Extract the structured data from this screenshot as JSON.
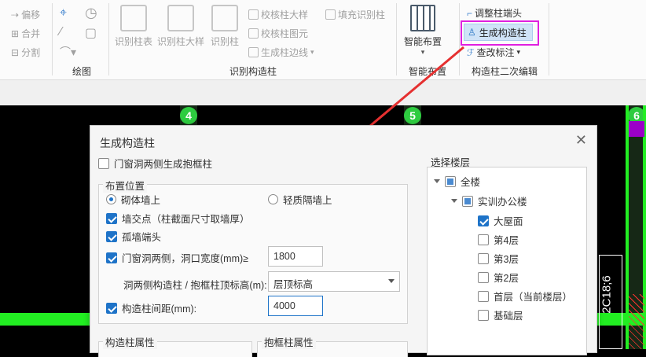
{
  "ribbon": {
    "group1_items": [
      "偏移",
      "合并",
      "分割"
    ],
    "draw_label": "绘图",
    "identify_buttons": [
      "识别柱表",
      "识别柱大样",
      "识别柱"
    ],
    "identify_small": [
      "校核柱大样",
      "校核柱图元",
      "生成柱边线",
      "填充识别柱"
    ],
    "identify_group_label": "识别构造柱",
    "smart_btn": "智能布置",
    "smart_group_label": "智能布置",
    "edit_items": [
      "调整柱端头",
      "生成构造柱",
      "查改标注"
    ],
    "edit_group_label": "构造柱二次编辑"
  },
  "axes": [
    "4",
    "5",
    "6"
  ],
  "cad_text": "2C18;6",
  "dialog": {
    "title": "生成构造柱",
    "door_window_both": "门窗洞两侧生成抱框柱",
    "layout_legend": "布置位置",
    "radio_masonry": "砌体墙上",
    "radio_light": "轻质隔墙上",
    "wall_intersection": "墙交点（柱截面尺寸取墙厚）",
    "isolated_wall_end": "孤墙端头",
    "door_window_sides": "门窗洞两侧，洞口宽度(mm)≥",
    "door_width_value": "1800",
    "top_elevation_label": "洞两侧构造柱 / 抱框柱顶标高(m):",
    "top_elevation_value": "层顶标高",
    "spacing_label": "构造柱间距(mm):",
    "spacing_value": "4000",
    "select_floor_legend": "选择楼层",
    "col_props_legend": "构造柱属性",
    "frame_props_legend": "抱框柱属性",
    "tree": {
      "root": "全楼",
      "building": "实训办公楼",
      "floors": [
        {
          "name": "大屋面",
          "checked": true
        },
        {
          "name": "第4层",
          "checked": false
        },
        {
          "name": "第3层",
          "checked": false
        },
        {
          "name": "第2层",
          "checked": false
        },
        {
          "name": "首层（当前楼层）",
          "checked": false
        },
        {
          "name": "基础层",
          "checked": false
        }
      ]
    }
  }
}
